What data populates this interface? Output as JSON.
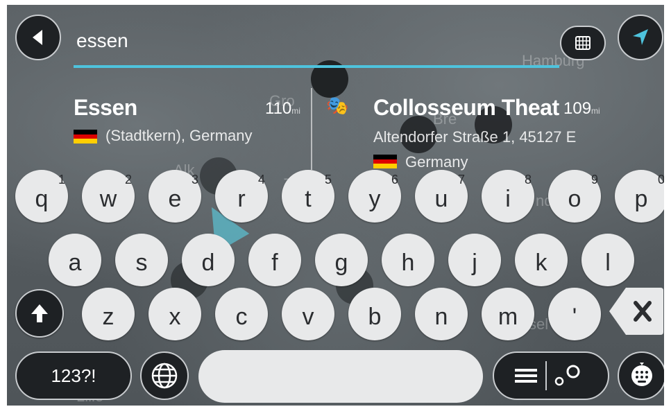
{
  "search": {
    "query": "essen"
  },
  "results": [
    {
      "title": "Essen",
      "distance": "110",
      "distance_unit": "mi",
      "line1": "(Stadtkern), Germany",
      "flag_colors": [
        "#000000",
        "#dd0000",
        "#ffce00"
      ]
    },
    {
      "title": "Collosseum Theat",
      "distance": "109",
      "distance_unit": "mi",
      "line1": "Altendorfer Straße 1, 45127 E",
      "line2": "Germany",
      "flag_colors": [
        "#000000",
        "#dd0000",
        "#ffce00"
      ]
    }
  ],
  "map_labels": [
    "Hamburg",
    "Gro",
    "Bre",
    "Alk",
    "Zw",
    "Lille",
    "sel",
    "nd"
  ],
  "keyboard": {
    "row1": [
      {
        "key": "q",
        "alt": "1"
      },
      {
        "key": "w",
        "alt": "2"
      },
      {
        "key": "e",
        "alt": "3"
      },
      {
        "key": "r",
        "alt": "4"
      },
      {
        "key": "t",
        "alt": "5"
      },
      {
        "key": "y",
        "alt": "6"
      },
      {
        "key": "u",
        "alt": "7"
      },
      {
        "key": "i",
        "alt": "8"
      },
      {
        "key": "o",
        "alt": "9"
      },
      {
        "key": "p",
        "alt": "0"
      }
    ],
    "row2": [
      "a",
      "s",
      "d",
      "f",
      "g",
      "h",
      "j",
      "k",
      "l"
    ],
    "row3": [
      "z",
      "x",
      "c",
      "v",
      "b",
      "n",
      "m",
      "'"
    ],
    "symbols_label": "123?!"
  },
  "colors": {
    "accent": "#4ec3dd",
    "key_bg": "#e8e9ea",
    "dark_btn": "#1e2124"
  }
}
